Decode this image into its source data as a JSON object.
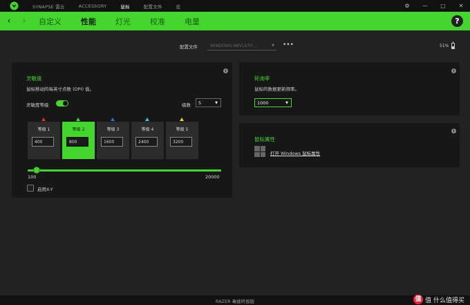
{
  "titlebar": {
    "tabs": [
      {
        "label": "SYNAPSE 雷云",
        "active": false
      },
      {
        "label": "ACCESSORY",
        "active": false
      },
      {
        "label": "鼠标",
        "active": true
      },
      {
        "label": "配置文件",
        "active": false
      },
      {
        "label": "宏",
        "active": false
      }
    ],
    "controls": {
      "settings": "⚙",
      "minimize": "—",
      "maximize": "▢",
      "close": "✕"
    }
  },
  "navbar": {
    "back": "‹",
    "forward": "›",
    "tabs": [
      {
        "label": "自定义",
        "active": false
      },
      {
        "label": "性能",
        "active": true
      },
      {
        "label": "灯光",
        "active": false
      },
      {
        "label": "校准",
        "active": false
      },
      {
        "label": "电量",
        "active": false
      }
    ],
    "help": "?"
  },
  "profile": {
    "label": "配置文件",
    "value": "WINDOWS-HKVL07H...",
    "more": "•••",
    "battery": "51%"
  },
  "sensitivity": {
    "title": "灵敏度",
    "description": "鼠标移动的每英寸点数 (DPI) 值。",
    "stages_label": "灵敏度等级",
    "stages_enabled": true,
    "levels_label": "级数",
    "levels_value": "5",
    "stages": [
      {
        "label": "等级 1",
        "dpi": "400",
        "color": "#e82c2c",
        "active": false
      },
      {
        "label": "等级 2",
        "dpi": "800",
        "color": "#44d62c",
        "active": true
      },
      {
        "label": "等级 3",
        "dpi": "1600",
        "color": "#2c6fe8",
        "active": false
      },
      {
        "label": "等级 4",
        "dpi": "2400",
        "color": "#2cc9e8",
        "active": false
      },
      {
        "label": "等级 5",
        "dpi": "3200",
        "color": "#e8d22c",
        "active": false
      }
    ],
    "slider_min": "100",
    "slider_max": "20000",
    "slider_value": 800,
    "xy_label": "启用X-Y",
    "xy_enabled": false
  },
  "polling": {
    "title": "轮询率",
    "description": "鼠标的数据更新频率。",
    "value": "1000"
  },
  "mouse_props": {
    "title": "鼠标属性",
    "link": "打开 Windows 鼠标属性"
  },
  "footer": {
    "device": "RAZER 毒蝰终极版",
    "watermark": "值 什么值得买"
  },
  "colors": {
    "accent": "#44d62c",
    "background": "#222222",
    "panel": "#171717"
  }
}
